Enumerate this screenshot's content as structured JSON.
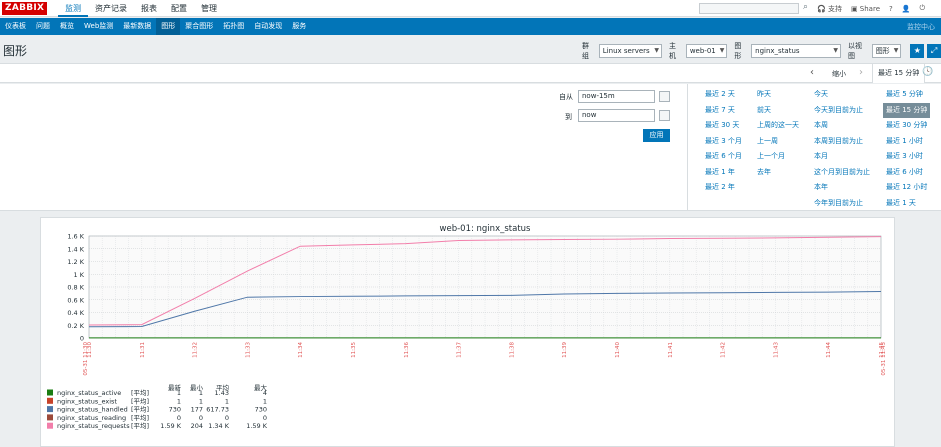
{
  "topbar": {
    "logo": "ZABBIX",
    "menu": [
      "监测",
      "资产记录",
      "报表",
      "配置",
      "管理"
    ],
    "support": "支持",
    "share": "Share",
    "help": "?"
  },
  "subnav": {
    "items": [
      "仪表板",
      "问题",
      "概览",
      "Web监测",
      "最新数据",
      "图形",
      "聚合图形",
      "拓扑图",
      "自动发现",
      "服务"
    ],
    "right": "监控中心"
  },
  "header": {
    "title": "图形",
    "group_label": "群组",
    "group_value": "Linux servers",
    "host_label": "主机",
    "host_value": "web-01",
    "graph_label": "图形",
    "graph_value": "nginx_status",
    "view_label": "以视图",
    "view_value": "图形"
  },
  "timebar": {
    "zoom_out": "缩小",
    "active": "最近 15 分钟"
  },
  "timepanel": {
    "from_label": "自从",
    "from_value": "now-15m",
    "to_label": "到",
    "to_value": "now",
    "apply": "应用",
    "col1": [
      "最近 2 天",
      "最近 7 天",
      "最近 30 天",
      "最近 3 个月",
      "最近 6 个月",
      "最近 1 年",
      "最近 2 年"
    ],
    "col2": [
      "昨天",
      "前天",
      "上周的这一天",
      "上一周",
      "上一个月",
      "去年"
    ],
    "col3": [
      "今天",
      "今天到目前为止",
      "本周",
      "本周到目前为止",
      "本月",
      "这个月到目前为止",
      "本年",
      "今年到目前为止"
    ],
    "col4": [
      "最近 5 分钟",
      "最近 15 分钟",
      "最近 30 分钟",
      "最近 1 小时",
      "最近 3 小时",
      "最近 6 小时",
      "最近 12 小时",
      "最近 1 天"
    ],
    "col4_selected": 1
  },
  "chart_data": {
    "type": "line",
    "title": "web-01: nginx_status",
    "ylim": [
      0,
      1600
    ],
    "y_ticks": [
      "0",
      "0.2 K",
      "0.4 K",
      "0.6 K",
      "0.8 K",
      "1 K",
      "1.2 K",
      "1.4 K",
      "1.6 K"
    ],
    "x": [
      "11:30",
      "11:31",
      "11:32",
      "11:33",
      "11:34",
      "11:35",
      "11:36",
      "11:37",
      "11:38",
      "11:39",
      "11:40",
      "11:41",
      "11:42",
      "11:43",
      "11:44",
      "11:45"
    ],
    "x_start_label": "05-31 11:30",
    "x_end_label": "05-31 11:45",
    "series": [
      {
        "name": "nginx_status_active",
        "color": "#1a7c11",
        "values": [
          1,
          1,
          1,
          1,
          1,
          1,
          1,
          1,
          1,
          1,
          1,
          1,
          1,
          1,
          1,
          1
        ]
      },
      {
        "name": "nginx_status_handled",
        "color": "#4f77a8",
        "values": [
          177,
          180,
          420,
          640,
          650,
          655,
          660,
          665,
          668,
          690,
          700,
          705,
          710,
          715,
          720,
          730
        ]
      },
      {
        "name": "nginx_status_requests",
        "color": "#f27eaa",
        "values": [
          204,
          210,
          620,
          1050,
          1440,
          1460,
          1480,
          1530,
          1540,
          1545,
          1550,
          1560,
          1565,
          1570,
          1580,
          1590
        ]
      }
    ],
    "legend_header": [
      "最新",
      "最小",
      "平均",
      "最大"
    ],
    "legend": [
      {
        "name": "nginx_status_active",
        "color": "#1a7c11",
        "tag": "[平均]",
        "last": "1",
        "min": "1",
        "avg": "1.43",
        "max": "4"
      },
      {
        "name": "nginx_status_exist",
        "color": "#c7432a",
        "tag": "[平均]",
        "last": "1",
        "min": "1",
        "avg": "1",
        "max": "1"
      },
      {
        "name": "nginx_status_handled",
        "color": "#4f77a8",
        "tag": "[平均]",
        "last": "730",
        "min": "177",
        "avg": "617.73",
        "max": "730"
      },
      {
        "name": "nginx_status_reading",
        "color": "#9c4a3a",
        "tag": "[平均]",
        "last": "0",
        "min": "0",
        "avg": "0",
        "max": "0"
      },
      {
        "name": "nginx_status_requests",
        "color": "#f27eaa",
        "tag": "[平均]",
        "last": "1.59 K",
        "min": "204",
        "avg": "1.34 K",
        "max": "1.59 K"
      }
    ]
  }
}
